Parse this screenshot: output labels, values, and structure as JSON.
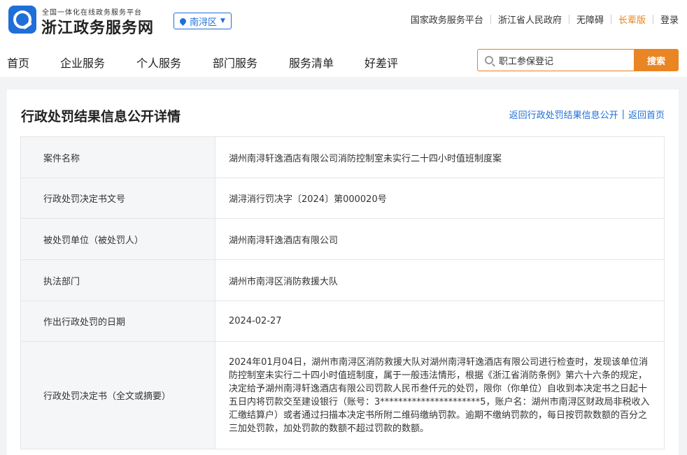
{
  "header": {
    "brand_sub": "全国一体化在线政务服务平台",
    "brand_main": "浙江政务服务网",
    "region": "南浔区",
    "links": [
      "国家政务服务平台",
      "浙江省人民政府",
      "无障碍",
      "长辈版",
      "登录"
    ],
    "accent_color": "#e8831a",
    "brand_color": "#1f6fd8"
  },
  "nav": {
    "items": [
      "首页",
      "企业服务",
      "个人服务",
      "部门服务",
      "服务清单",
      "好差评"
    ]
  },
  "search": {
    "value": "职工参保登记",
    "button_label": "搜索"
  },
  "page": {
    "title": "行政处罚结果信息公开详情",
    "back_list": "返回行政处罚结果信息公开",
    "back_home": "返回首页"
  },
  "details": {
    "rows": [
      {
        "label": "案件名称",
        "value": "湖州南浔轩逸酒店有限公司消防控制室未实行二十四小时值班制度案"
      },
      {
        "label": "行政处罚决定书文号",
        "value": "湖浔消行罚决字〔2024〕第000020号"
      },
      {
        "label": "被处罚单位（被处罚人）",
        "value": "湖州南浔轩逸酒店有限公司"
      },
      {
        "label": "执法部门",
        "value": "湖州市南浔区消防救援大队"
      },
      {
        "label": "作出行政处罚的日期",
        "value": "2024-02-27"
      },
      {
        "label": "行政处罚决定书（全文或摘要）",
        "value": "2024年01月04日，湖州市南浔区消防救援大队对湖州南浔轩逸酒店有限公司进行检查时，发现该单位消防控制室未实行二十四小时值班制度，属于一般违法情形，根据《浙江省消防条例》第六十六条的规定，决定给予湖州南浔轩逸酒店有限公司罚款人民币叁仟元的处罚，限你（你单位）自收到本决定书之日起十五日内将罚款交至建设银行（账号：3**********************5，账户名：湖州市南浔区财政局非税收入汇缴结算户）或者通过扫描本决定书所附二维码缴纳罚款。逾期不缴纳罚款的，每日按罚款数额的百分之三加处罚款，加处罚款的数额不超过罚款的数额。"
      }
    ]
  }
}
